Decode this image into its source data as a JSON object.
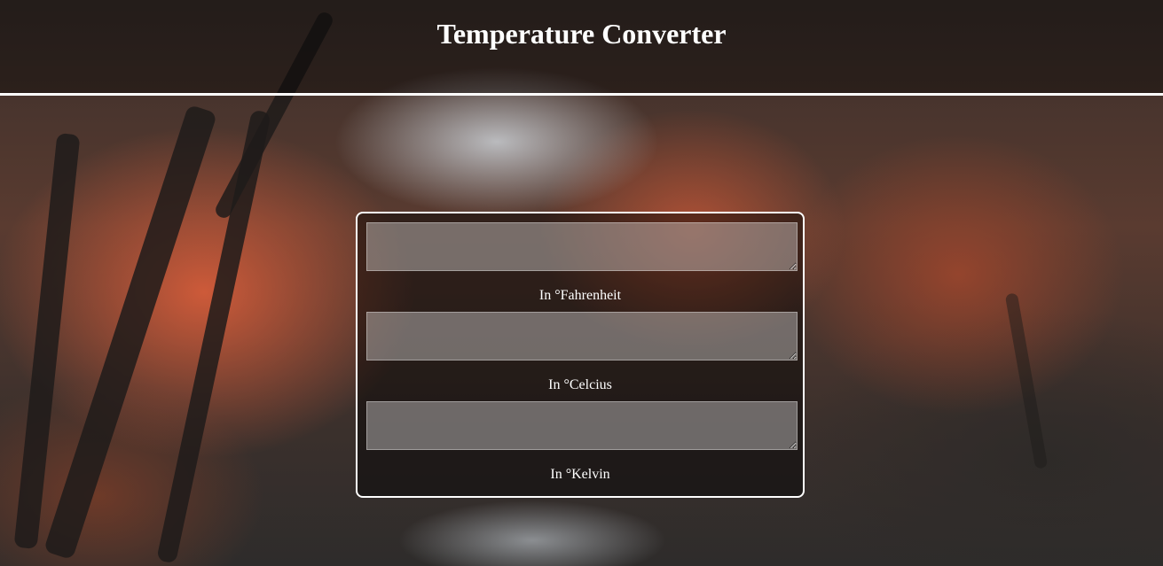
{
  "header": {
    "title": "Temperature Converter"
  },
  "converter": {
    "fields": [
      {
        "value": "",
        "label": "In °Fahrenheit"
      },
      {
        "value": "",
        "label": "In °Celcius"
      },
      {
        "value": "",
        "label": "In °Kelvin"
      }
    ]
  },
  "colors": {
    "text": "#ffffff",
    "panel_border": "#ffffff",
    "header_rule": "#ffffff"
  }
}
